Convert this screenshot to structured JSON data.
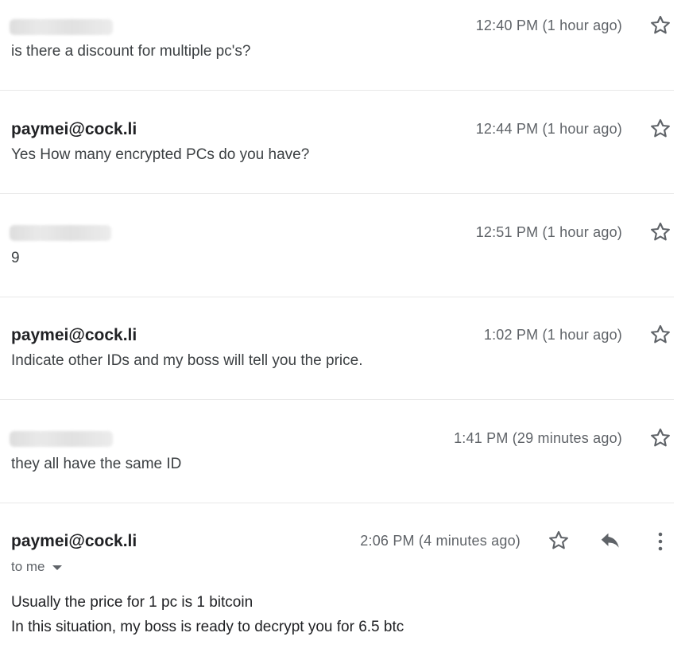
{
  "messages": [
    {
      "sender": "",
      "sender_redacted": true,
      "time": "12:40 PM (1 hour ago)",
      "snippet": "is there a discount for multiple pc's?"
    },
    {
      "sender": "paymei@cock.li",
      "sender_redacted": false,
      "time": "12:44 PM (1 hour ago)",
      "snippet": "Yes How many encrypted PCs do you have?"
    },
    {
      "sender": "",
      "sender_redacted": true,
      "time": "12:51 PM (1 hour ago)",
      "snippet": "9"
    },
    {
      "sender": "paymei@cock.li",
      "sender_redacted": false,
      "time": "1:02 PM (1 hour ago)",
      "snippet": "Indicate other IDs and my boss will tell you the price."
    },
    {
      "sender": "",
      "sender_redacted": true,
      "time": "1:41 PM (29 minutes ago)",
      "snippet": "they all have the same ID"
    }
  ],
  "expanded_message": {
    "sender": "paymei@cock.li",
    "time": "2:06 PM (4 minutes ago)",
    "recipient_label": "to me",
    "body_lines": [
      "Usually the price for 1 pc is 1 bitcoin",
      "In this situation, my boss is ready to decrypt you for 6.5 btc"
    ]
  },
  "icons": {
    "star": "star-outline-icon",
    "reply": "reply-icon",
    "more": "more-vertical-icon",
    "caret": "caret-down-icon"
  },
  "colors": {
    "text_primary": "#202124",
    "text_secondary": "#5f6368",
    "divider": "#e8e8e8",
    "icon": "#5f6368"
  }
}
